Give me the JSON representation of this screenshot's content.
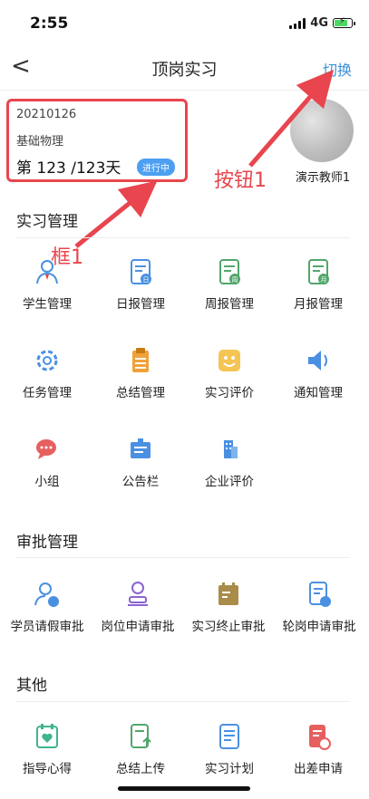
{
  "status": {
    "time": "2:55",
    "network": "4G"
  },
  "nav": {
    "back": "<",
    "title": "顶岗实习",
    "switch": "切换"
  },
  "card": {
    "code": "20210126",
    "course": "基础物理",
    "days": "第 123 /123天",
    "status": "进行中"
  },
  "teacher": {
    "name": "演示教师1"
  },
  "annotations": {
    "button": "按钮1",
    "box": "框1"
  },
  "sections": {
    "internship": "实习管理",
    "approval": "审批管理",
    "other": "其他"
  },
  "internship_items": [
    "学生管理",
    "日报管理",
    "周报管理",
    "月报管理",
    "任务管理",
    "总结管理",
    "实习评价",
    "通知管理",
    "小组",
    "公告栏",
    "企业评价"
  ],
  "approval_items": [
    "学员请假审批",
    "岗位申请审批",
    "实习终止审批",
    "轮岗申请审批"
  ],
  "other_items": [
    "指导心得",
    "总结上传",
    "实习计划",
    "出差申请"
  ],
  "icons": {
    "internship": [
      "student-icon",
      "daily-report-icon",
      "weekly-report-icon",
      "monthly-report-icon",
      "task-gear-icon",
      "summary-clipboard-icon",
      "smiley-evaluation-icon",
      "speaker-icon",
      "chat-bubble-icon",
      "bulletin-board-icon",
      "building-icon"
    ],
    "approval": [
      "leave-person-icon",
      "position-stamp-icon",
      "termination-calendar-icon",
      "rotation-doc-icon"
    ],
    "other": [
      "heart-board-icon",
      "upload-doc-icon",
      "plan-doc-icon",
      "business-trip-icon"
    ]
  },
  "colors": {
    "accent": "#3a8fd9",
    "annotation": "#e8454e",
    "badge": "#4d9ff2"
  }
}
